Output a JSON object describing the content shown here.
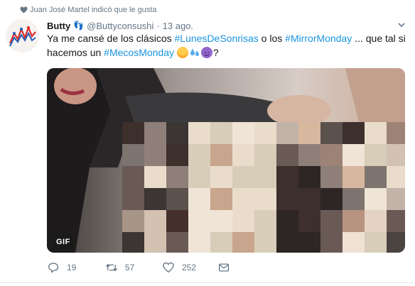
{
  "social_context": {
    "liked_by_text": "Juan José Martel indicó que le gusta",
    "icon": "heart-icon"
  },
  "tweet": {
    "display_name": "Butty",
    "name_emoji": "👣",
    "handle": "@Buttyconsushi",
    "separator": "·",
    "date": "13 ago.",
    "text_parts": {
      "p1": "Ya me cansé de los clásicos ",
      "h1": "#LunesDeSonrisas",
      "p2": " o los ",
      "h2": "#MirrorMonday",
      "p3": " ... que tal si hacemos un ",
      "h3": "#MecosMonday",
      "p4": " ",
      "p5": "?"
    },
    "media": {
      "badge": "GIF",
      "pixelated_region": true
    },
    "actions": {
      "replies": "19",
      "retweets": "57",
      "likes": "252"
    }
  },
  "colors": {
    "hashtag": "#1b95e0",
    "muted": "#657786",
    "text": "#14171a"
  }
}
